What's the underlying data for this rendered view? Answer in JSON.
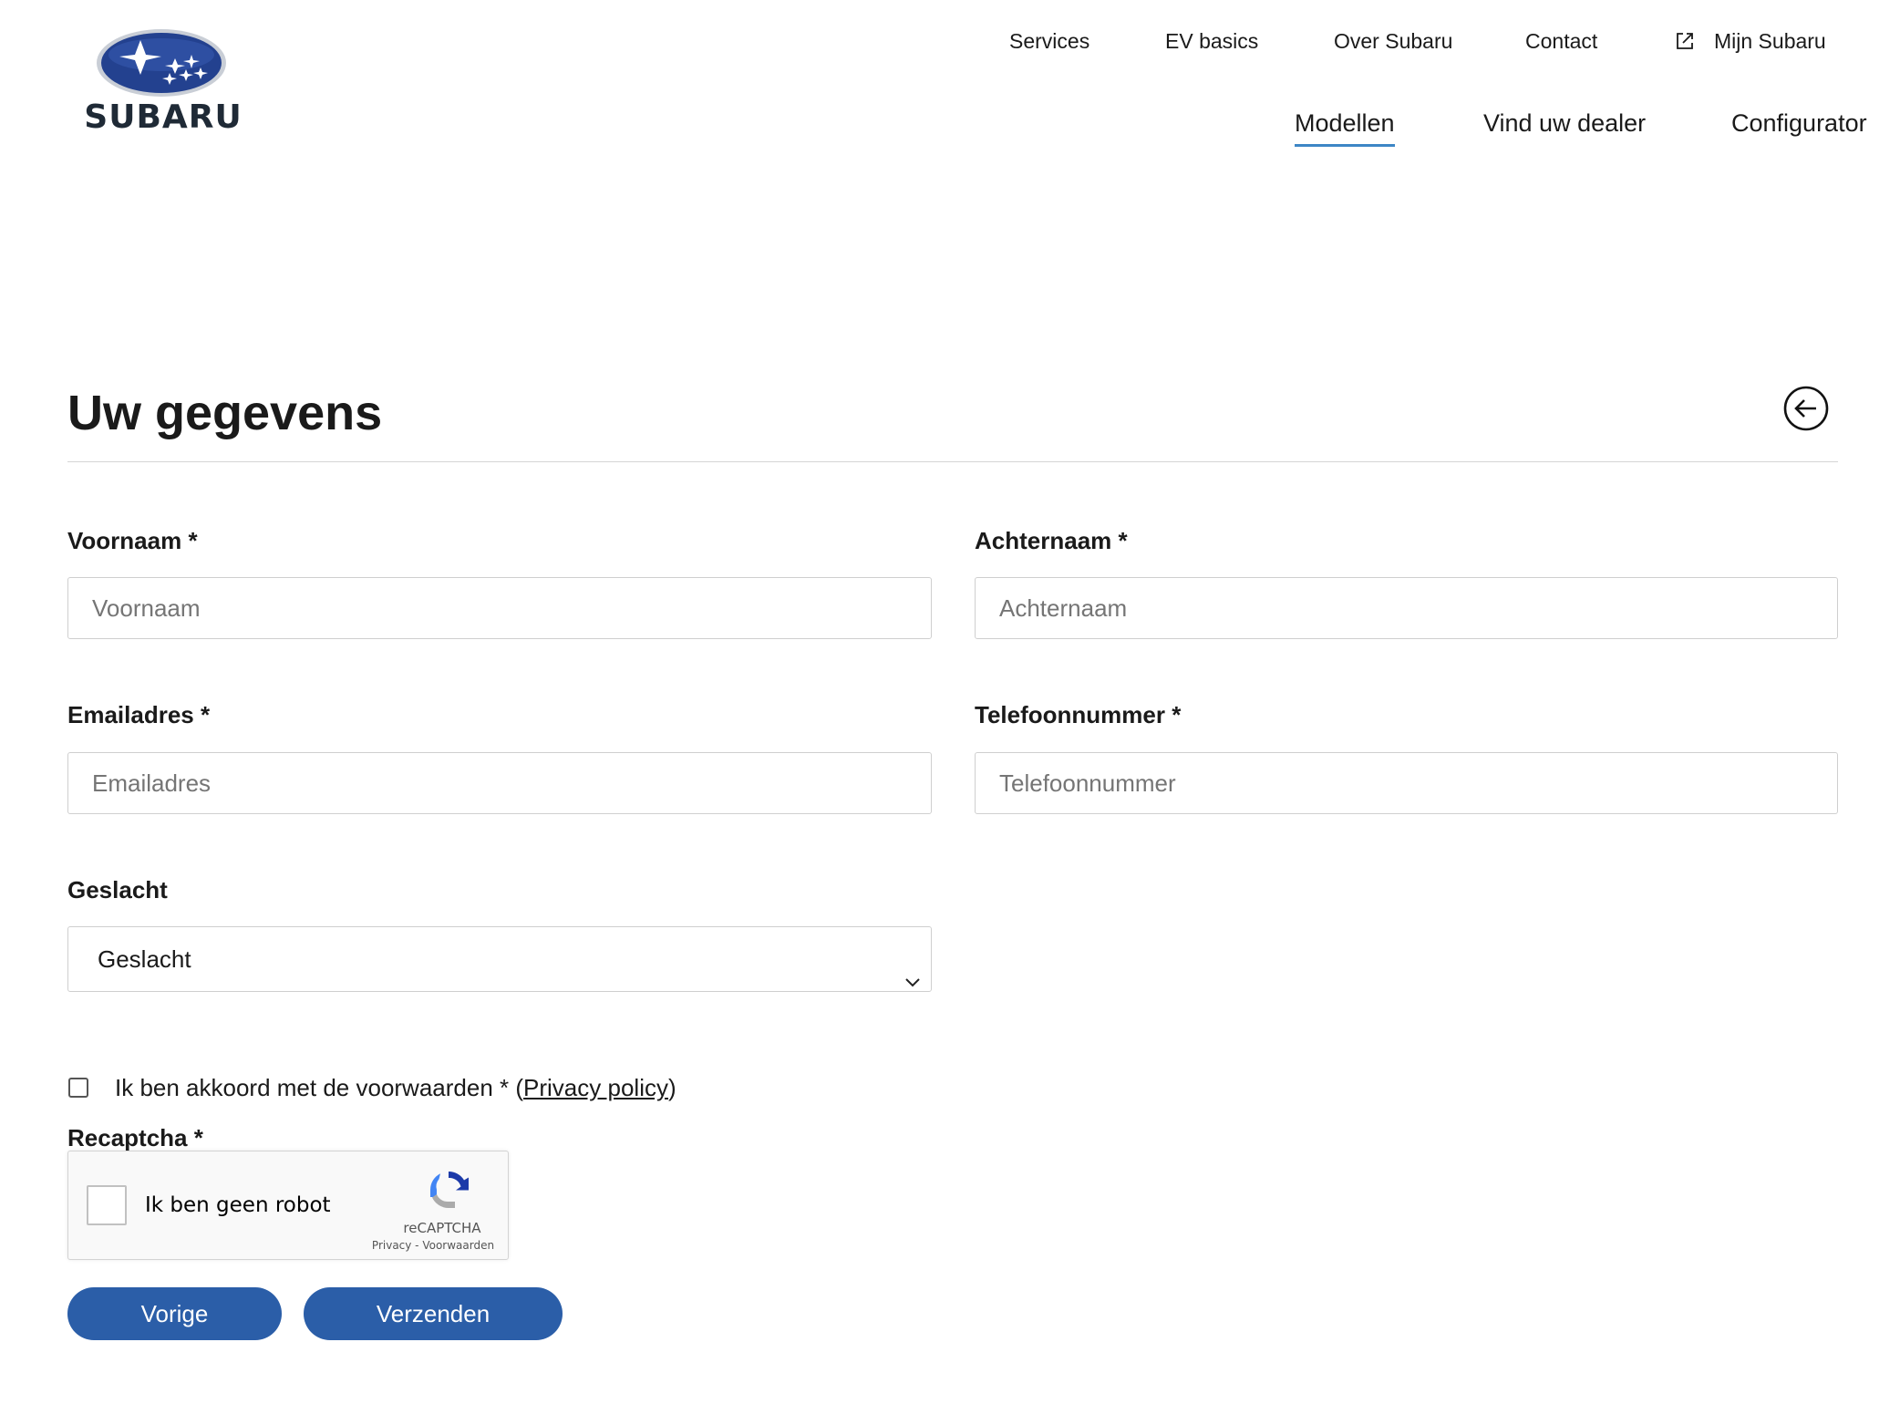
{
  "brand": {
    "name": "SUBARU",
    "logo_icon": "subaru-stars-logo-icon",
    "colors": {
      "logo_blue": "#23418f",
      "accent": "#3d86c6",
      "button": "#2b5ea8"
    }
  },
  "top_nav": [
    {
      "label": "Services"
    },
    {
      "label": "EV basics"
    },
    {
      "label": "Over Subaru"
    },
    {
      "label": "Contact"
    },
    {
      "label": "Mijn Subaru",
      "icon": "external-link-icon"
    }
  ],
  "main_nav": [
    {
      "label": "Modellen",
      "active": true
    },
    {
      "label": "Vind uw dealer"
    },
    {
      "label": "Configurator"
    }
  ],
  "page": {
    "title": "Uw gegevens",
    "back_icon": "arrow-left-circle-icon"
  },
  "form": {
    "first_name": {
      "label": "Voornaam",
      "required": "*",
      "placeholder": "Voornaam",
      "value": ""
    },
    "last_name": {
      "label": "Achternaam",
      "required": "*",
      "placeholder": "Achternaam",
      "value": ""
    },
    "email": {
      "label": "Emailadres",
      "required": "*",
      "placeholder": "Emailadres",
      "value": ""
    },
    "phone": {
      "label": "Telefoonnummer",
      "required": "*",
      "placeholder": "Telefoonnummer",
      "value": ""
    },
    "gender": {
      "label": "Geslacht",
      "selected": "Geslacht"
    },
    "consent": {
      "text": "Ik ben akkoord met de voorwaarden * (",
      "link": "Privacy policy",
      "suffix": ")"
    },
    "recaptcha": {
      "label": "Recaptcha",
      "required": "*",
      "checkbox_text": "Ik ben geen robot",
      "brand": "reCAPTCHA",
      "links": "Privacy - Voorwaarden"
    }
  },
  "buttons": {
    "previous": "Vorige",
    "submit": "Verzenden"
  }
}
